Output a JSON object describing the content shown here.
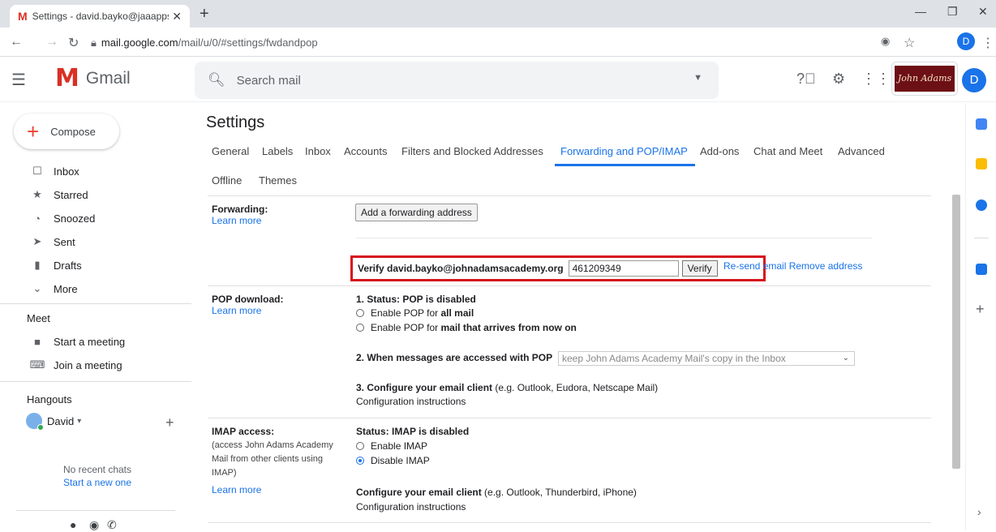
{
  "browser": {
    "tab_title": "Settings - david.bayko@jaaapps.",
    "tab_favicon": "M",
    "url_domain": "mail.google.com",
    "url_path": "/mail/u/0/#settings/fwdandpop",
    "profile_initial": "D"
  },
  "header": {
    "app_name": "Gmail",
    "search_placeholder": "Search mail",
    "org_logo_text": "John Adams",
    "avatar_initial": "D"
  },
  "sidebar": {
    "compose": "Compose",
    "items": [
      {
        "label": "Inbox",
        "icon": "inbox-icon"
      },
      {
        "label": "Starred",
        "icon": "star-icon"
      },
      {
        "label": "Snoozed",
        "icon": "clock-icon"
      },
      {
        "label": "Sent",
        "icon": "send-icon"
      },
      {
        "label": "Drafts",
        "icon": "draft-icon"
      },
      {
        "label": "More",
        "icon": "chevron-down-icon"
      }
    ],
    "meet_title": "Meet",
    "meet_items": [
      "Start a meeting",
      "Join a meeting"
    ],
    "hangouts_title": "Hangouts",
    "hangouts_user": "David",
    "no_chats": "No recent chats",
    "start_new": "Start a new one"
  },
  "settings": {
    "title": "Settings",
    "tabs": [
      "General",
      "Labels",
      "Inbox",
      "Accounts",
      "Filters and Blocked Addresses",
      "Forwarding and POP/IMAP",
      "Add-ons",
      "Chat and Meet",
      "Advanced",
      "Offline",
      "Themes"
    ],
    "active_tab": "Forwarding and POP/IMAP",
    "forwarding": {
      "label": "Forwarding:",
      "learn_more": "Learn more",
      "add_button": "Add a forwarding address",
      "verify_label": "Verify david.bayko@johnadamsacademy.org",
      "code_value": "461209349",
      "verify_button": "Verify",
      "resend": "Re-send email",
      "remove": "Remove address"
    },
    "pop": {
      "label": "POP download:",
      "learn_more": "Learn more",
      "status": "1. Status: POP is disabled",
      "opt1_prefix": "Enable POP for ",
      "opt1_bold": "all mail",
      "opt2_prefix": "Enable POP for ",
      "opt2_bold": "mail that arrives from now on",
      "access_label": "2. When messages are accessed with POP",
      "access_value": "keep John Adams Academy Mail's copy in the Inbox",
      "configure_bold": "3. Configure your email client",
      "configure_rest": " (e.g. Outlook, Eudora, Netscape Mail)",
      "instructions": "Configuration instructions"
    },
    "imap": {
      "label": "IMAP access:",
      "desc1": "(access John Adams Academy",
      "desc2": "Mail from other clients using",
      "desc3": "IMAP)",
      "learn_more": "Learn more",
      "status": "Status: IMAP is disabled",
      "enable": "Enable IMAP",
      "disable": "Disable IMAP",
      "configure_bold": "Configure your email client",
      "configure_rest": " (e.g. Outlook, Thunderbird, iPhone)",
      "instructions": "Configuration instructions"
    }
  },
  "colors": {
    "accent": "#1a73e8",
    "highlight_border": "#d6121d"
  }
}
